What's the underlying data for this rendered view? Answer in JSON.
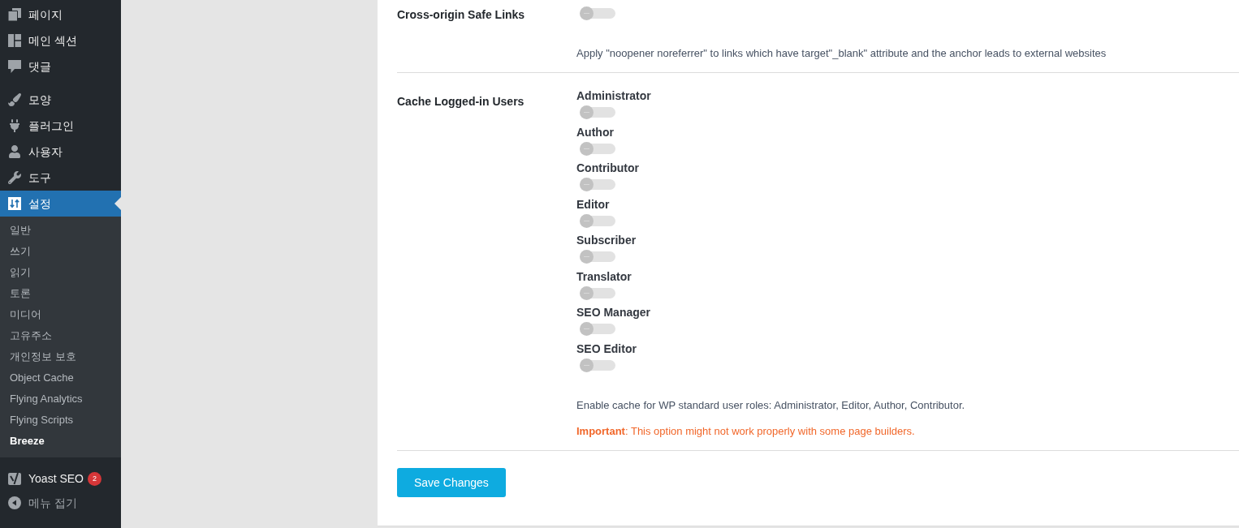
{
  "sidebar": {
    "sections": [
      {
        "items": [
          {
            "label": "페이지",
            "selected": false
          },
          {
            "label": "메인 섹션",
            "selected": false
          },
          {
            "label": "댓글",
            "selected": false
          }
        ]
      },
      {
        "items": [
          {
            "label": "모양",
            "selected": false
          },
          {
            "label": "플러그인",
            "selected": false
          },
          {
            "label": "사용자",
            "selected": false
          },
          {
            "label": "도구",
            "selected": false
          },
          {
            "label": "설정",
            "selected": true,
            "children": [
              {
                "label": "일반",
                "selected": false
              },
              {
                "label": "쓰기",
                "selected": false
              },
              {
                "label": "읽기",
                "selected": false
              },
              {
                "label": "토론",
                "selected": false
              },
              {
                "label": "미디어",
                "selected": false
              },
              {
                "label": "고유주소",
                "selected": false
              },
              {
                "label": "개인정보 보호",
                "selected": false
              },
              {
                "label": "Object Cache",
                "selected": false
              },
              {
                "label": "Flying Analytics",
                "selected": false
              },
              {
                "label": "Flying Scripts",
                "selected": false
              },
              {
                "label": "Breeze",
                "selected": true
              }
            ]
          },
          {
            "label": "Yoast SEO",
            "selected": false,
            "badge": "2"
          }
        ]
      }
    ],
    "collapse_label": "메뉴 접기"
  },
  "settings": {
    "rows": [
      {
        "kind": "toggle",
        "label": "Cross-origin Safe Links",
        "on": false,
        "description": "Apply \"noopener noreferrer\" to links which have target\"_blank\" attribute and the anchor leads to external websites"
      },
      {
        "kind": "role_toggles",
        "label": "Cache Logged-in Users",
        "roles": [
          {
            "name": "Administrator",
            "on": false
          },
          {
            "name": "Author",
            "on": false
          },
          {
            "name": "Contributor",
            "on": false
          },
          {
            "name": "Editor",
            "on": false
          },
          {
            "name": "Subscriber",
            "on": false
          },
          {
            "name": "Translator",
            "on": false
          },
          {
            "name": "SEO Manager",
            "on": false
          },
          {
            "name": "SEO Editor",
            "on": false
          }
        ],
        "description": "Enable cache for WP standard user roles: Administrator, Editor, Author, Contributor.",
        "note": "**Important**: This option might not work properly with some page builders."
      }
    ]
  },
  "save_button": {
    "label": "Save Changes"
  }
}
